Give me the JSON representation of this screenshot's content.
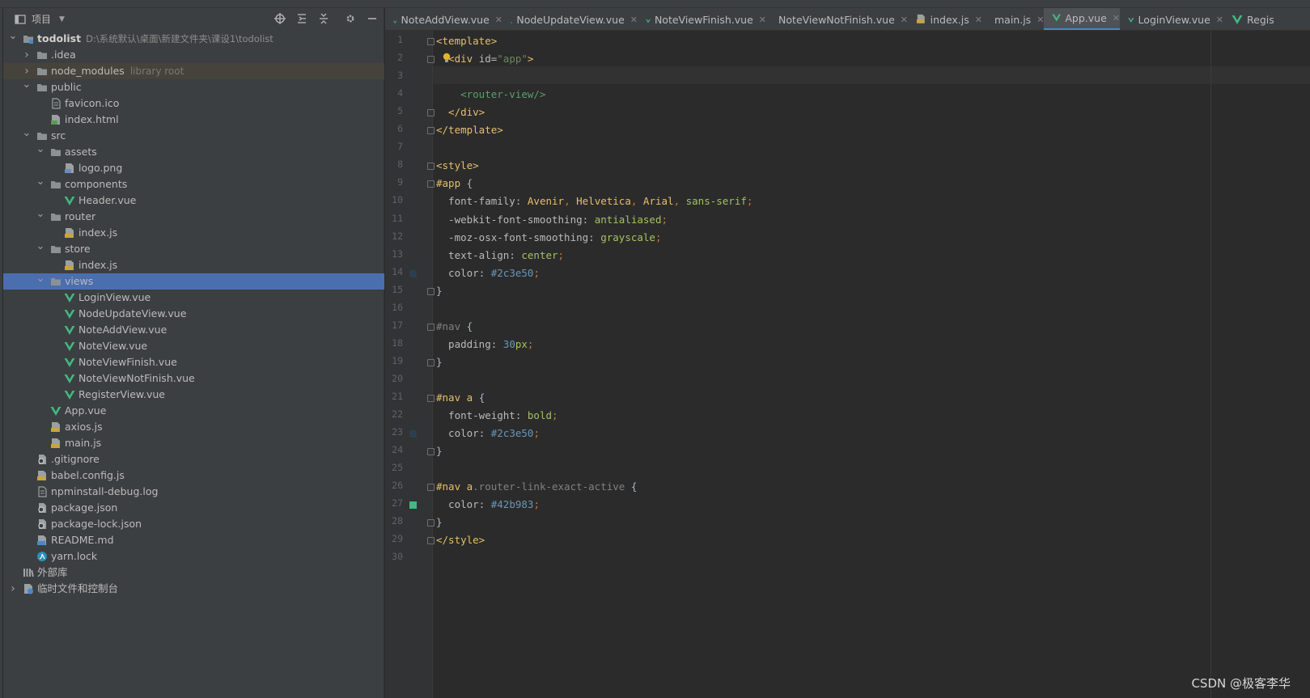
{
  "project_panel": {
    "title": "项目",
    "tree": [
      {
        "label": "todolist",
        "path": "D:\\系统默认\\桌面\\新建文件夹\\课设1\\todolist",
        "indent": 0,
        "arrow": "down",
        "icon": "folder-module"
      },
      {
        "label": ".idea",
        "indent": 1,
        "arrow": "right",
        "icon": "folder"
      },
      {
        "label": "node_modules",
        "hint": "library root",
        "indent": 1,
        "arrow": "right",
        "icon": "folder",
        "state": "lib"
      },
      {
        "label": "public",
        "indent": 1,
        "arrow": "down",
        "icon": "folder"
      },
      {
        "label": "favicon.ico",
        "indent": 2,
        "icon": "file"
      },
      {
        "label": "index.html",
        "indent": 2,
        "icon": "html"
      },
      {
        "label": "src",
        "indent": 1,
        "arrow": "down",
        "icon": "folder"
      },
      {
        "label": "assets",
        "indent": 2,
        "arrow": "down",
        "icon": "folder"
      },
      {
        "label": "logo.png",
        "indent": 3,
        "icon": "image"
      },
      {
        "label": "components",
        "indent": 2,
        "arrow": "down",
        "icon": "folder"
      },
      {
        "label": "Header.vue",
        "indent": 3,
        "icon": "vue"
      },
      {
        "label": "router",
        "indent": 2,
        "arrow": "down",
        "icon": "folder"
      },
      {
        "label": "index.js",
        "indent": 3,
        "icon": "js"
      },
      {
        "label": "store",
        "indent": 2,
        "arrow": "down",
        "icon": "folder"
      },
      {
        "label": "index.js",
        "indent": 3,
        "icon": "js"
      },
      {
        "label": "views",
        "indent": 2,
        "arrow": "down",
        "icon": "folder",
        "state": "selected"
      },
      {
        "label": "LoginView.vue",
        "indent": 3,
        "icon": "vue"
      },
      {
        "label": "NodeUpdateView.vue",
        "indent": 3,
        "icon": "vue"
      },
      {
        "label": "NoteAddView.vue",
        "indent": 3,
        "icon": "vue"
      },
      {
        "label": "NoteView.vue",
        "indent": 3,
        "icon": "vue"
      },
      {
        "label": "NoteViewFinish.vue",
        "indent": 3,
        "icon": "vue"
      },
      {
        "label": "NoteViewNotFinish.vue",
        "indent": 3,
        "icon": "vue"
      },
      {
        "label": "RegisterView.vue",
        "indent": 3,
        "icon": "vue"
      },
      {
        "label": "App.vue",
        "indent": 2,
        "icon": "vue"
      },
      {
        "label": "axios.js",
        "indent": 2,
        "icon": "js"
      },
      {
        "label": "main.js",
        "indent": 2,
        "icon": "js"
      },
      {
        "label": ".gitignore",
        "indent": 1,
        "icon": "config"
      },
      {
        "label": "babel.config.js",
        "indent": 1,
        "icon": "js"
      },
      {
        "label": "npminstall-debug.log",
        "indent": 1,
        "icon": "text"
      },
      {
        "label": "package.json",
        "indent": 1,
        "icon": "config"
      },
      {
        "label": "package-lock.json",
        "indent": 1,
        "icon": "config"
      },
      {
        "label": "README.md",
        "indent": 1,
        "icon": "md"
      },
      {
        "label": "yarn.lock",
        "indent": 1,
        "icon": "yarn"
      },
      {
        "label": "外部库",
        "indent": 0,
        "icon": "library"
      },
      {
        "label": "临时文件和控制台",
        "indent": 0,
        "arrow": "right",
        "icon": "scratch"
      }
    ]
  },
  "tabs": [
    {
      "label": "NoteAddView.vue",
      "icon": "vue"
    },
    {
      "label": "NodeUpdateView.vue",
      "icon": "vue"
    },
    {
      "label": "NoteViewFinish.vue",
      "icon": "vue"
    },
    {
      "label": "NoteViewNotFinish.vue",
      "icon": "vue"
    },
    {
      "label": "index.js",
      "icon": "js"
    },
    {
      "label": "main.js",
      "icon": "js"
    },
    {
      "label": "App.vue",
      "icon": "vue",
      "active": true
    },
    {
      "label": "LoginView.vue",
      "icon": "vue"
    },
    {
      "label": "Regis",
      "icon": "vue"
    }
  ],
  "editor": {
    "line_numbers": [
      "1",
      "2",
      "3",
      "4",
      "5",
      "6",
      "7",
      "8",
      "9",
      "10",
      "11",
      "12",
      "13",
      "14",
      "15",
      "16",
      "17",
      "18",
      "19",
      "20",
      "21",
      "22",
      "23",
      "24",
      "25",
      "26",
      "27",
      "28",
      "29",
      "30"
    ],
    "lines": [
      [
        {
          "t": "<template>",
          "c": "tag"
        }
      ],
      [
        {
          "t": "  <div ",
          "c": "tag"
        },
        {
          "t": "id",
          "c": "attr"
        },
        {
          "t": "=",
          "c": "attr"
        },
        {
          "t": "\"app\"",
          "c": "str"
        },
        {
          "t": ">",
          "c": "tag"
        }
      ],
      [],
      [
        {
          "t": "    <router-view/>",
          "c": "comp"
        }
      ],
      [
        {
          "t": "  </div>",
          "c": "tag"
        }
      ],
      [
        {
          "t": "</template>",
          "c": "tag"
        }
      ],
      [],
      [
        {
          "t": "<style>",
          "c": "tag"
        }
      ],
      [
        {
          "t": "#app ",
          "c": "sel"
        },
        {
          "t": "{",
          "c": "selg"
        }
      ],
      [
        {
          "t": "  font-family",
          "c": "prop"
        },
        {
          "t": ": ",
          "c": "selg"
        },
        {
          "t": "Avenir",
          "c": "sel"
        },
        {
          "t": ", ",
          "c": "punc"
        },
        {
          "t": "Helvetica",
          "c": "sel"
        },
        {
          "t": ", ",
          "c": "punc"
        },
        {
          "t": "Arial",
          "c": "sel"
        },
        {
          "t": ", ",
          "c": "punc"
        },
        {
          "t": "sans-serif",
          "c": "val"
        },
        {
          "t": ";",
          "c": "punc"
        }
      ],
      [
        {
          "t": "  -webkit-font-smoothing",
          "c": "prop"
        },
        {
          "t": ": ",
          "c": "selg"
        },
        {
          "t": "antialiased",
          "c": "val"
        },
        {
          "t": ";",
          "c": "punc"
        }
      ],
      [
        {
          "t": "  -moz-osx-font-smoothing",
          "c": "prop"
        },
        {
          "t": ": ",
          "c": "selg"
        },
        {
          "t": "grayscale",
          "c": "val"
        },
        {
          "t": ";",
          "c": "punc"
        }
      ],
      [
        {
          "t": "  text-align",
          "c": "prop"
        },
        {
          "t": ": ",
          "c": "selg"
        },
        {
          "t": "center",
          "c": "val"
        },
        {
          "t": ";",
          "c": "punc"
        }
      ],
      [
        {
          "t": "  color",
          "c": "prop"
        },
        {
          "t": ": ",
          "c": "selg"
        },
        {
          "t": "#2c3e50",
          "c": "num"
        },
        {
          "t": ";",
          "c": "punc"
        }
      ],
      [
        {
          "t": "}",
          "c": "selg"
        }
      ],
      [],
      [
        {
          "t": "#nav ",
          "c": "grey"
        },
        {
          "t": "{",
          "c": "selg"
        }
      ],
      [
        {
          "t": "  padding",
          "c": "prop"
        },
        {
          "t": ": ",
          "c": "selg"
        },
        {
          "t": "30",
          "c": "num"
        },
        {
          "t": "px",
          "c": "val"
        },
        {
          "t": ";",
          "c": "punc"
        }
      ],
      [
        {
          "t": "}",
          "c": "selg"
        }
      ],
      [],
      [
        {
          "t": "#nav a ",
          "c": "sel"
        },
        {
          "t": "{",
          "c": "selg"
        }
      ],
      [
        {
          "t": "  font-weight",
          "c": "prop"
        },
        {
          "t": ": ",
          "c": "selg"
        },
        {
          "t": "bold",
          "c": "val"
        },
        {
          "t": ";",
          "c": "punc"
        }
      ],
      [
        {
          "t": "  color",
          "c": "prop"
        },
        {
          "t": ": ",
          "c": "selg"
        },
        {
          "t": "#2c3e50",
          "c": "num"
        },
        {
          "t": ";",
          "c": "punc"
        }
      ],
      [
        {
          "t": "}",
          "c": "selg"
        }
      ],
      [],
      [
        {
          "t": "#nav a",
          "c": "sel"
        },
        {
          "t": ".router-link-exact-active ",
          "c": "grey"
        },
        {
          "t": "{",
          "c": "selg"
        }
      ],
      [
        {
          "t": "  color",
          "c": "prop"
        },
        {
          "t": ": ",
          "c": "selg"
        },
        {
          "t": "#42b983",
          "c": "num"
        },
        {
          "t": ";",
          "c": "punc"
        }
      ],
      [
        {
          "t": "}",
          "c": "selg"
        }
      ],
      [
        {
          "t": "</style>",
          "c": "tag"
        }
      ],
      []
    ],
    "color_swatches": [
      {
        "line": 14,
        "color": "#2c3e50"
      },
      {
        "line": 23,
        "color": "#2c3e50"
      },
      {
        "line": 27,
        "color": "#42b983"
      }
    ]
  },
  "watermark": "CSDN @极客李华",
  "colors": {
    "accent": "#4a88c7",
    "selection": "#4b6eaf",
    "vue": "#41b883",
    "js_badge": "#c9a53a"
  }
}
